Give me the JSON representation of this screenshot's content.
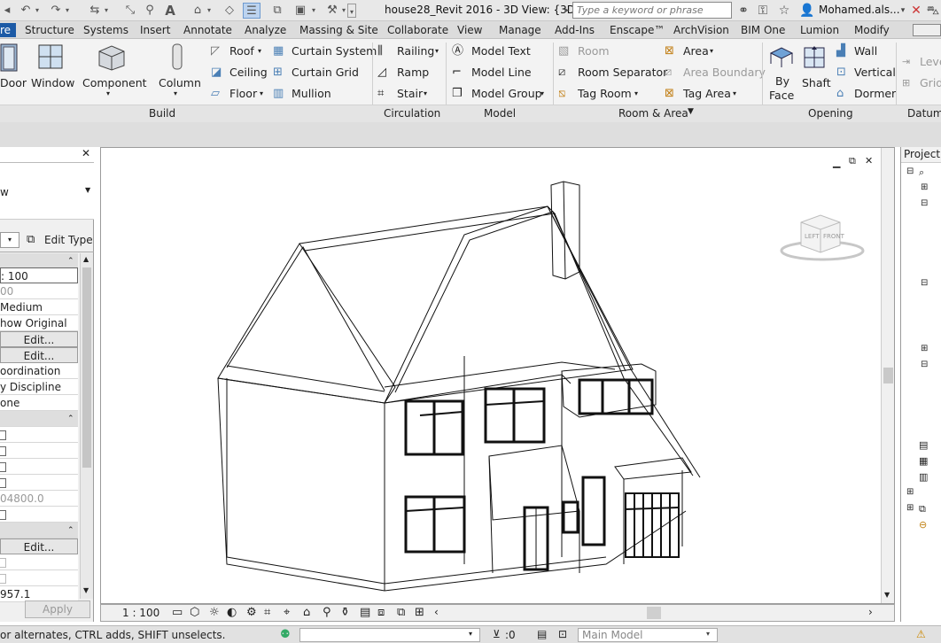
{
  "window": {
    "title": "house28_Revit 2016 - 3D View: {3D}",
    "search_placeholder": "Type a keyword or phrase",
    "user": "Mohamed.als..."
  },
  "tabs": [
    {
      "label": "re",
      "active": true
    },
    {
      "label": "Structure"
    },
    {
      "label": "Systems"
    },
    {
      "label": "Insert"
    },
    {
      "label": "Annotate"
    },
    {
      "label": "Analyze"
    },
    {
      "label": "Massing & Site"
    },
    {
      "label": "Collaborate"
    },
    {
      "label": "View"
    },
    {
      "label": "Manage"
    },
    {
      "label": "Add-Ins"
    },
    {
      "label": "Enscape™"
    },
    {
      "label": "ArchVision"
    },
    {
      "label": "BIM One"
    },
    {
      "label": "Lumion"
    },
    {
      "label": "Modify"
    }
  ],
  "ribbon": {
    "build": {
      "door": "Door",
      "window": "Window",
      "component": "Component",
      "column": "Column",
      "roof": "Roof",
      "ceiling": "Ceiling",
      "floor": "Floor",
      "curtain_system": "Curtain System",
      "curtain_grid": "Curtain Grid",
      "mullion": "Mullion",
      "label": "Build"
    },
    "circulation": {
      "railing": "Railing",
      "ramp": "Ramp",
      "stair": "Stair",
      "label": "Circulation"
    },
    "model": {
      "model_text": "Model Text",
      "model_line": "Model Line",
      "model_group": "Model Group",
      "label": "Model"
    },
    "room_area": {
      "room": "Room",
      "room_separator": "Room Separator",
      "tag_room": "Tag Room",
      "area": "Area",
      "area_boundary": "Area Boundary",
      "tag_area": "Tag Area",
      "label": "Room & Area"
    },
    "opening": {
      "by_face": "By Face",
      "by_face_l1": "By",
      "by_face_l2": "Face",
      "shaft": "Shaft",
      "wall": "Wall",
      "vertical": "Vertical",
      "dormer": "Dormer",
      "label": "Opening"
    },
    "datum": {
      "level": "Leve",
      "grid": "Grid",
      "label": "Datum"
    }
  },
  "properties": {
    "type_dropdown": "w",
    "edit_type": "Edit Type",
    "rows": [
      ": 100",
      "00",
      "Medium",
      "how Original",
      "Edit...",
      "Edit...",
      "oordination",
      "y Discipline",
      "one"
    ],
    "value_row": "04800.0",
    "edit_bottom": "Edit...",
    "last_value": "957.1",
    "apply": "Apply"
  },
  "viewport": {
    "viewcube_left": "LEFT",
    "viewcube_front": "FRONT",
    "scale": "1 : 100"
  },
  "browser": {
    "title": "Project B"
  },
  "status": {
    "hint": "or alternates, CTRL adds, SHIFT unselects.",
    "selection_count": ":0",
    "model": "Main Model"
  },
  "colors": {
    "active_tab": "#1c5aa6",
    "ribbon_bg": "#f3f3f3",
    "titlebar_bg": "#e8e8e8"
  }
}
